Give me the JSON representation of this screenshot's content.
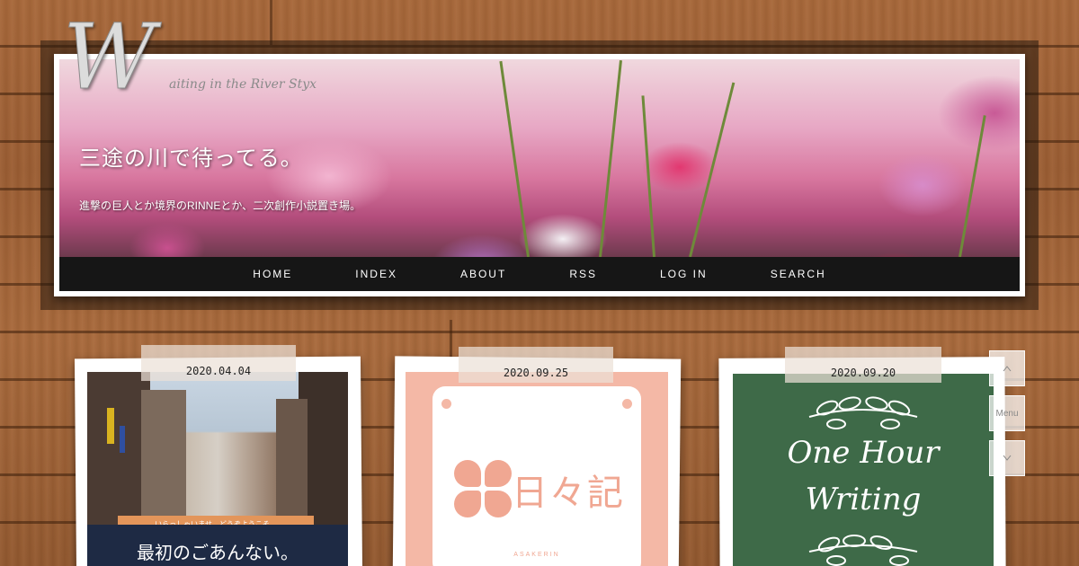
{
  "header": {
    "logo_letter": "W",
    "logo_tagline": "aiting in the River Styx",
    "site_title": "三途の川で待ってる。",
    "site_description": "進撃の巨人とか境界のRINNEとか、二次創作小説置き場。"
  },
  "nav": {
    "items": [
      "HOME",
      "INDEX",
      "ABOUT",
      "RSS",
      "LOG IN",
      "SEARCH"
    ]
  },
  "cards": [
    {
      "date": "2020.04.04",
      "ribbon": "いらっしゃいませ、どうぞようこそ。",
      "caption": "最初のごあんない。"
    },
    {
      "date": "2020.09.25",
      "title": "日々記",
      "small": "ASAKERIN"
    },
    {
      "date": "2020.09.20",
      "lines": [
        "One Hour",
        "Writing"
      ]
    }
  ],
  "side_controls": {
    "up_icon": "chevron-up-icon",
    "menu_label": "Menu",
    "down_icon": "chevron-down-icon"
  },
  "colors": {
    "wood": "#a1633a",
    "nav_bg": "#161616",
    "card2_accent": "#f4b8a6",
    "card3_bg": "#3e6a48",
    "card1_caption_bg": "#1e2a44",
    "card1_ribbon": "#e3955a"
  }
}
